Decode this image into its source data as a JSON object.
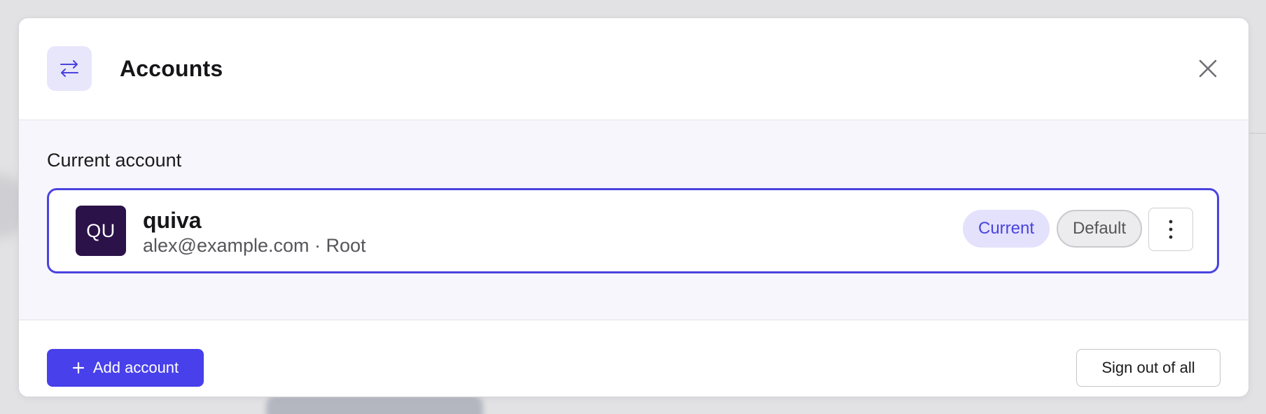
{
  "dialog": {
    "title": "Accounts",
    "icon": "swap-arrows-icon",
    "accent_color": "#4a43e0"
  },
  "current_section": {
    "label": "Current account",
    "account": {
      "initials": "QU",
      "name": "quiva",
      "email_role": "alex@example.com · Root",
      "avatar_color": "#2b1249",
      "badges": {
        "current": "Current",
        "default": "Default"
      }
    }
  },
  "footer": {
    "add_account_label": "Add account",
    "sign_out_label": "Sign out of all"
  }
}
